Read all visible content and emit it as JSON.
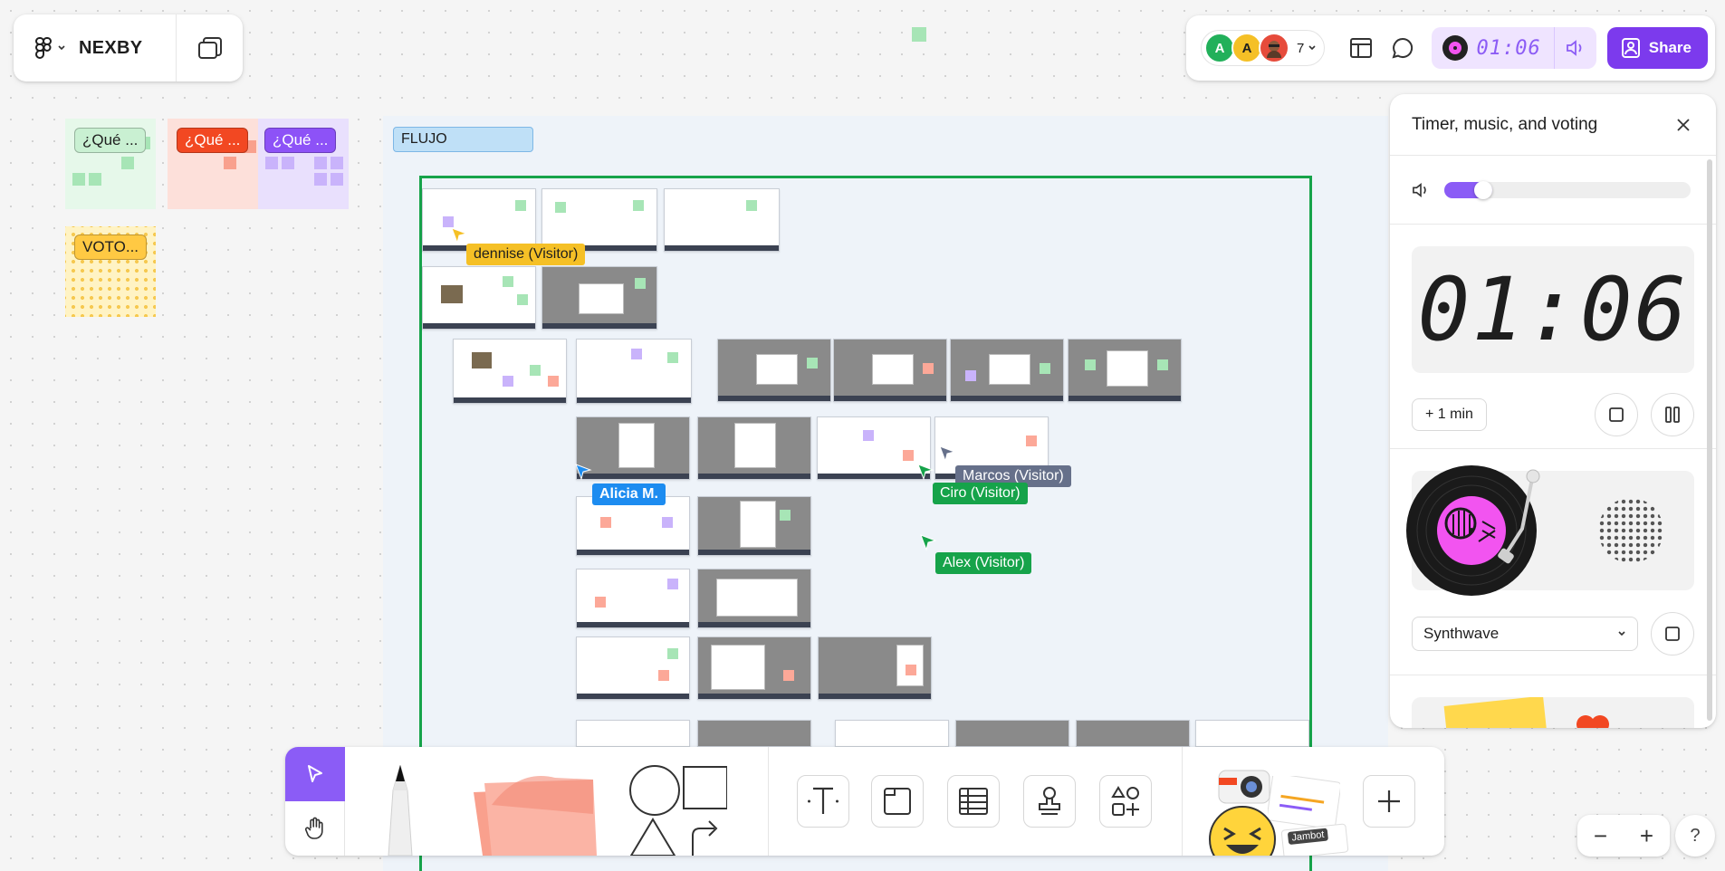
{
  "app": {
    "name": "NEXBY"
  },
  "collaborators": {
    "avatars": [
      {
        "initial": "A",
        "color": "#22b05a"
      },
      {
        "initial": "A",
        "color": "#f5c026"
      },
      {
        "initial": "",
        "color": "#e64b3b"
      }
    ],
    "count": "7"
  },
  "header": {
    "timer_value": "01:06",
    "share_label": "Share"
  },
  "panel": {
    "title": "Timer, music, and voting",
    "volume_level": 0.12,
    "clock_display": "01:06",
    "add_minute_label": "+ 1 min",
    "music_option": "Synthwave"
  },
  "board": {
    "flujo_label": "FLUJO",
    "tag_1": "¿Qué ...",
    "tag_2": "¿Qué ...",
    "tag_3": "¿Qué ...",
    "tag_4": "VOTO...",
    "tag_colors": {
      "green": "#c9f0d2",
      "red": "#f24822",
      "purple": "#9747ff",
      "yellow": "#ffc943"
    }
  },
  "cursors": [
    {
      "name": "dennise (Visitor)",
      "color": "#f5c026"
    },
    {
      "name": "Alicia M.",
      "color": "#1d8cf0"
    },
    {
      "name": "Marcos (Visitor)",
      "color": "#66708a"
    },
    {
      "name": "Ciro (Visitor)",
      "color": "#16a34a"
    },
    {
      "name": "Alex (Visitor)",
      "color": "#16a34a"
    }
  ],
  "toolbar": {
    "jambot_label": "Jambot"
  },
  "zoom": {
    "minus": "−",
    "plus": "+",
    "help": "?"
  }
}
